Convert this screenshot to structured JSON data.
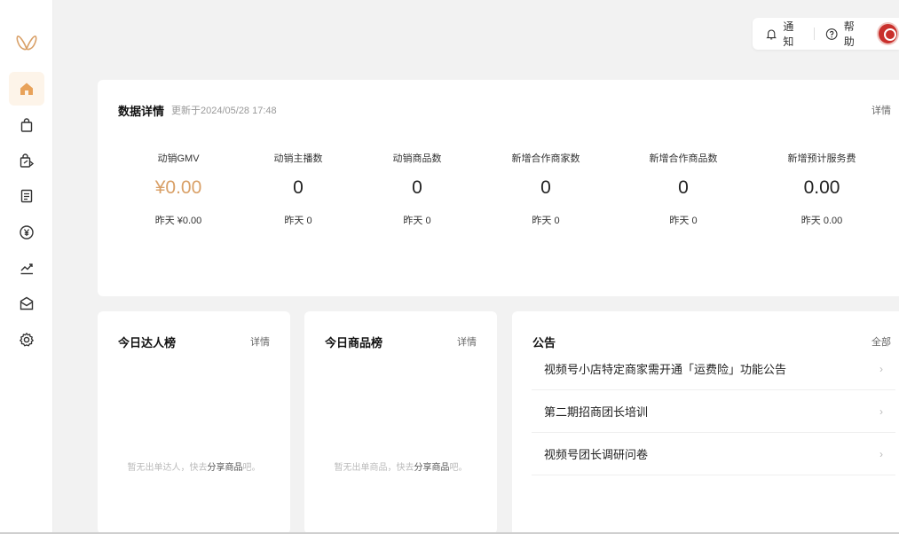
{
  "colors": {
    "accent": "#d9a067",
    "accent_bg": "#fdf4e9"
  },
  "sidebar": {
    "logo_icon": "butterfly-logo-icon",
    "items": [
      {
        "icon": "home-icon",
        "active": true
      },
      {
        "icon": "shopping-bag-icon"
      },
      {
        "icon": "product-share-icon"
      },
      {
        "icon": "clipboard-icon"
      },
      {
        "icon": "yen-circle-icon"
      },
      {
        "icon": "trend-chart-icon"
      },
      {
        "icon": "mail-icon"
      },
      {
        "icon": "gear-icon"
      }
    ]
  },
  "topbar": {
    "notify_label": "通知",
    "help_label": "帮助"
  },
  "stats": {
    "title": "数据详情",
    "updated": "更新于2024/05/28 17:48",
    "detail_link": "详情",
    "metrics": [
      {
        "label": "动销GMV",
        "value": "¥0.00",
        "yesterday": "昨天  ¥0.00"
      },
      {
        "label": "动销主播数",
        "value": "0",
        "yesterday": "昨天  0"
      },
      {
        "label": "动销商品数",
        "value": "0",
        "yesterday": "昨天  0"
      },
      {
        "label": "新增合作商家数",
        "value": "0",
        "yesterday": "昨天  0"
      },
      {
        "label": "新增合作商品数",
        "value": "0",
        "yesterday": "昨天  0"
      },
      {
        "label": "新增预计服务费",
        "value": "0.00",
        "yesterday": "昨天  0.00"
      }
    ]
  },
  "talent_rank": {
    "title": "今日达人榜",
    "detail_link": "详情",
    "empty_prefix": "暂无出单达人，快去",
    "empty_link": "分享商品",
    "empty_suffix": "吧。"
  },
  "product_rank": {
    "title": "今日商品榜",
    "detail_link": "详情",
    "empty_prefix": "暂无出单商品，快去",
    "empty_link": "分享商品",
    "empty_suffix": "吧。"
  },
  "notices": {
    "title": "公告",
    "all_link": "全部",
    "items": [
      {
        "text": "视频号小店特定商家需开通「运费险」功能公告"
      },
      {
        "text": "第二期招商团长培训"
      },
      {
        "text": "视频号团长调研问卷"
      }
    ]
  }
}
